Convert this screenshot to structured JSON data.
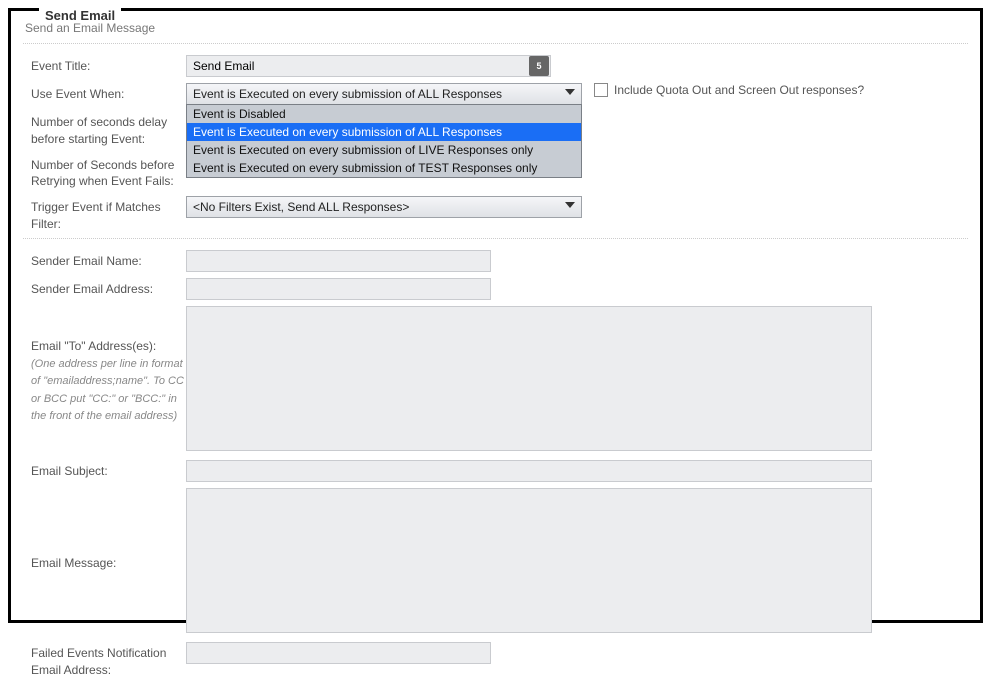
{
  "panel": {
    "legend": "Send Email",
    "subtitle": "Send an Email Message"
  },
  "labels": {
    "event_title": "Event Title:",
    "use_event_when": "Use Event When:",
    "seconds_delay": "Number of seconds delay before starting Event:",
    "seconds_before_retry": "Number of Seconds before Retrying when Event Fails:",
    "trigger_filter": "Trigger Event if Matches Filter:",
    "sender_name": "Sender Email Name:",
    "sender_address": "Sender Email Address:",
    "email_to_main": "Email \"To\" Address(es):",
    "email_to_hint": "(One address per line in format of \"emailaddress;name\". To CC or BCC put \"CC:\" or \"BCC:\" in the front of the email address)",
    "email_subject": "Email Subject:",
    "email_message": "Email Message:",
    "failed_notify": "Failed Events Notification Email Address:"
  },
  "fields": {
    "event_title": "Send Email",
    "use_event_when": "Event is Executed on every submission of ALL Responses",
    "use_event_when_options": [
      "Event is Disabled",
      "Event is Executed on every submission of ALL Responses",
      "Event is Executed on every submission of LIVE Responses only",
      "Event is Executed on every submission of TEST Responses only"
    ],
    "use_event_when_selected_index": 1,
    "include_quota_label": "Include Quota Out and Screen Out responses?",
    "include_quota_checked": false,
    "trigger_filter": "<No Filters Exist, Send ALL Responses>",
    "sender_name": "",
    "sender_address": "",
    "email_to": "",
    "email_subject": "",
    "email_message": "",
    "failed_notify": ""
  },
  "icons": {
    "title_badge": "5"
  }
}
